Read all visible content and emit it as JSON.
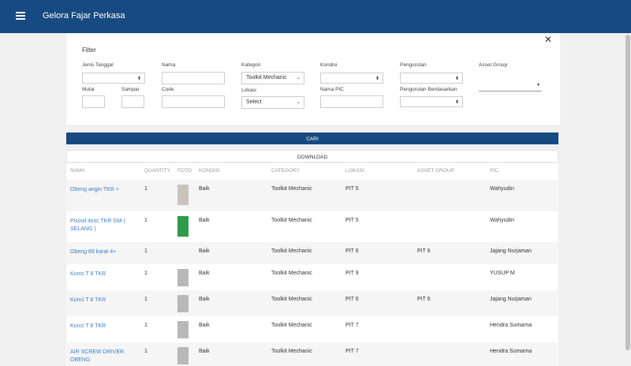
{
  "app": {
    "title": "Gelora Fajar Perkasa"
  },
  "filter": {
    "title": "Filter",
    "jenis_tanggal_label": "Jenis Tanggal",
    "mulai_label": "Mulai",
    "sampai_label": "Sampai",
    "nama_label": "Nama",
    "code_label": "Code",
    "kategori_label": "Kategori",
    "kategori_value": "Toolkit Mechanic",
    "lokasi_label": "Lokasi",
    "lokasi_value": "Select",
    "kondisi_label": "Kondisi",
    "nama_pic_label": "Nama PIC",
    "pengurutan_label": "Pengurutan",
    "pengurutan_berdasarkan_label": "Pengurutan Berdasarkan",
    "asset_group_label": "Asset Group"
  },
  "buttons": {
    "cari": "CARI",
    "download": "DOWNLOAD"
  },
  "table": {
    "headers": [
      "NAMA",
      "QUANTITY",
      "FOTO",
      "KONDISI",
      "CATEGORY",
      "LOKASI",
      "ASSET GROUP",
      "PIC"
    ],
    "rows": [
      {
        "nama": "Obeng angin TKR +",
        "qty": "1",
        "kondisi": "Baik",
        "category": "Toolkit Mechanic",
        "lokasi": "PIT 5",
        "asset_group": "",
        "pic": "Wahyudin",
        "photo": "#c9c4be"
      },
      {
        "nama": "Pisosil itosc TKR GM ( SELANG )",
        "qty": "1",
        "kondisi": "Baik",
        "category": "Toolkit Mechanic",
        "lokasi": "PIT 5",
        "asset_group": "",
        "pic": "Wahyudin",
        "photo": "#2f9a4a"
      },
      {
        "nama": "Obeng 69 karat 4+",
        "qty": "1",
        "kondisi": "Baik",
        "category": "Toolkit Mechanic",
        "lokasi": "PIT 6",
        "asset_group": "PIT 6",
        "pic": "Jajang Nurjaman",
        "photo": ""
      },
      {
        "nama": "Kunci T 8 TKR",
        "qty": "1",
        "kondisi": "Baik",
        "category": "Toolkit Mechanic",
        "lokasi": "PIT 9",
        "asset_group": "",
        "pic": "YUSUP M",
        "photo": "#b8b8b8"
      },
      {
        "nama": "Kunci T 8 TKR",
        "qty": "1",
        "kondisi": "Baik",
        "category": "Toolkit Mechanic",
        "lokasi": "PIT 6",
        "asset_group": "PIT 6",
        "pic": "Jajang Nurjaman",
        "photo": "#b8b8b8"
      },
      {
        "nama": "Kunci T 8 TKR",
        "qty": "1",
        "kondisi": "Baik",
        "category": "Toolkit Mechanic",
        "lokasi": "PIT 7",
        "asset_group": "",
        "pic": "Hendra Sumarna",
        "photo": "#b8b8b8"
      },
      {
        "nama": "AIR SCREW DRIVER OBENG",
        "qty": "1",
        "kondisi": "Baik",
        "category": "Toolkit Mechanic",
        "lokasi": "PIT 7",
        "asset_group": "",
        "pic": "Hendra Sumarna",
        "photo": "#b8b8b8"
      }
    ]
  }
}
